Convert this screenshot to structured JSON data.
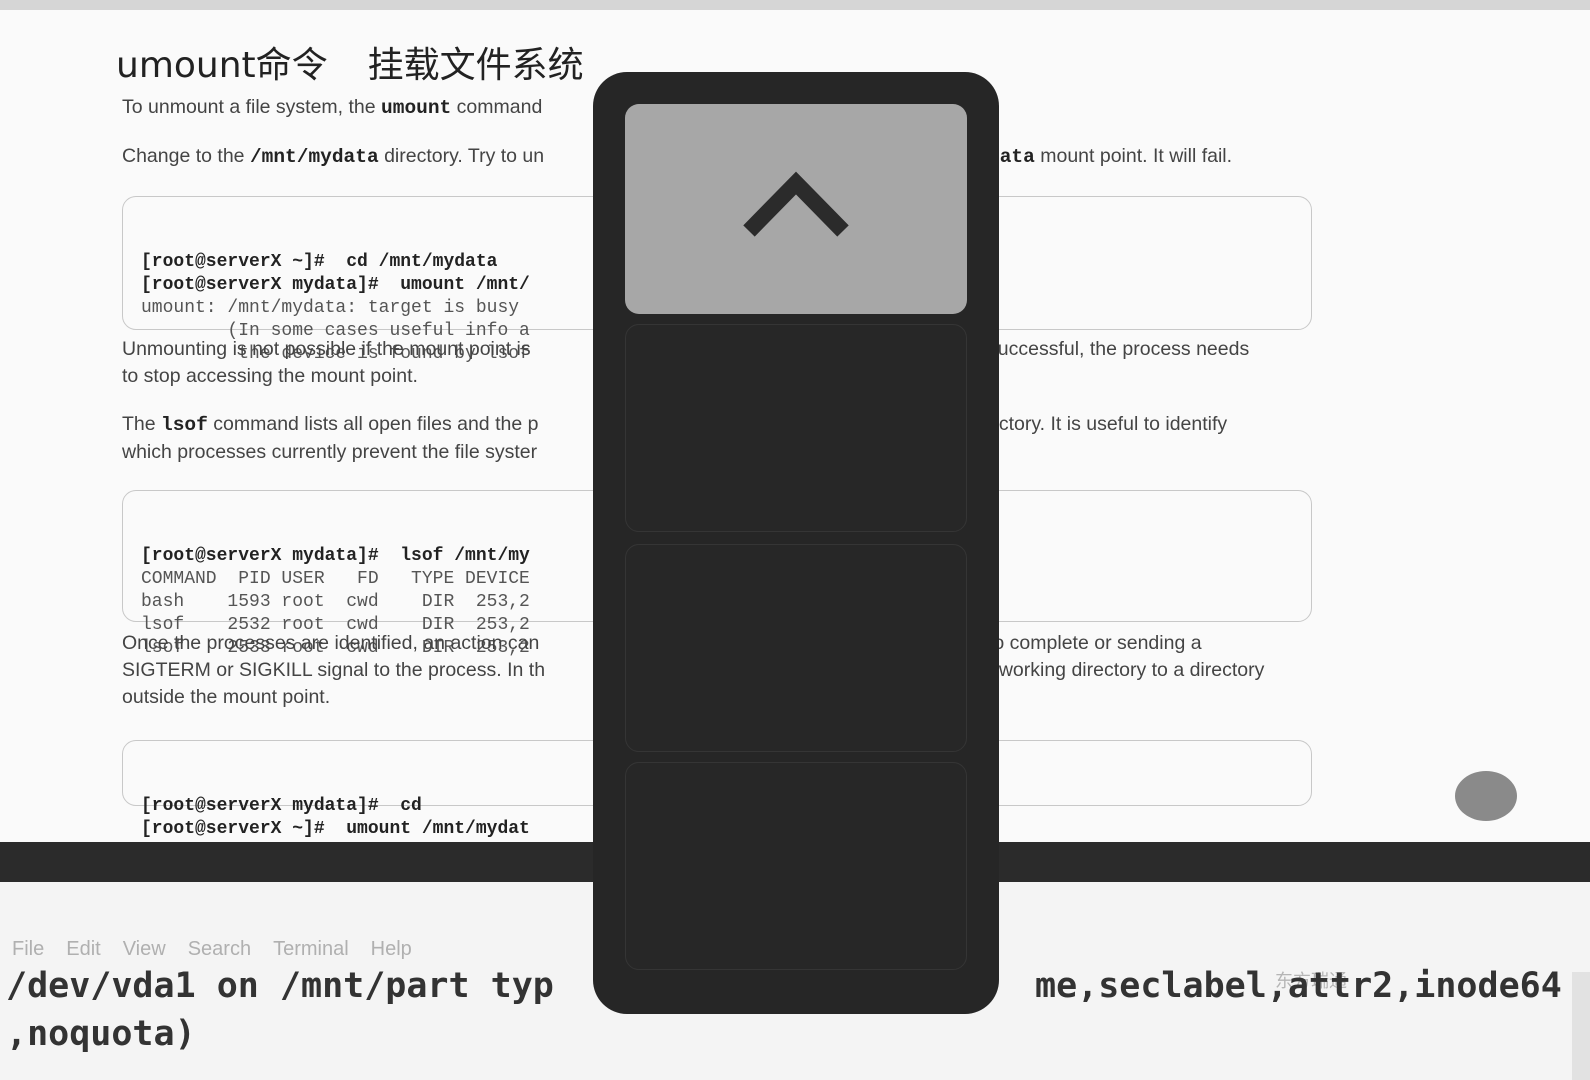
{
  "slide": {
    "title_cmd": "umount命令",
    "title_desc": "挂载文件系统",
    "para1": {
      "pre": "To unmount a file system, the ",
      "code": "umount",
      "post": " command"
    },
    "para2": {
      "pre": "Change to the ",
      "code": "/mnt/mydata",
      "post": " directory. Try to un"
    },
    "para2_right": {
      "code": "data",
      "post": " mount point. It will fail."
    },
    "cmd1": [
      "[root@serverX ~]#  cd /mnt/mydata",
      "[root@serverX mydata]#  umount /mnt/",
      "umount: /mnt/mydata: target is busy",
      "        (In some cases useful info a",
      "         the device is found by lsof"
    ],
    "para3_lines": [
      "Unmounting is not possible if the mount point is",
      "to stop accessing the mount point."
    ],
    "para3_right": "successful, the process needs",
    "para4": {
      "pre": "The ",
      "code": "lsof",
      "post": " command lists all open files and the p",
      "line2": "which processes currently prevent the file syster"
    },
    "para4_right": "ectory. It is useful to identify",
    "cmd2": [
      "[root@serverX mydata]#  lsof /mnt/my",
      "COMMAND  PID USER   FD   TYPE DEVICE",
      "bash    1593 root  cwd    DIR  253,2",
      "lsof    2532 root  cwd    DIR  253,2",
      "lsof    2533 root  cwd    DIR  253,2"
    ],
    "para5_lines": [
      "Once the processes are identified, an action can",
      "SIGTERM or SIGKILL signal to the process. In th",
      "outside the mount point."
    ],
    "para5_right": [
      "to complete or sending a",
      "t working directory to a directory"
    ],
    "cmd3": [
      "[root@serverX mydata]#  cd",
      "[root@serverX ~]#  umount /mnt/mydat"
    ]
  },
  "terminal": {
    "menu": [
      "File",
      "Edit",
      "View",
      "Search",
      "Terminal",
      "Help"
    ],
    "line1_left": "/dev/vda1 on /mnt/part typ",
    "line1_right": "me,seclabel,attr2,inode64",
    "line2": ",noquota)",
    "watermark": "东方瑞通"
  },
  "overlay": {
    "icons": {
      "up": "chevron-up-icon"
    }
  }
}
